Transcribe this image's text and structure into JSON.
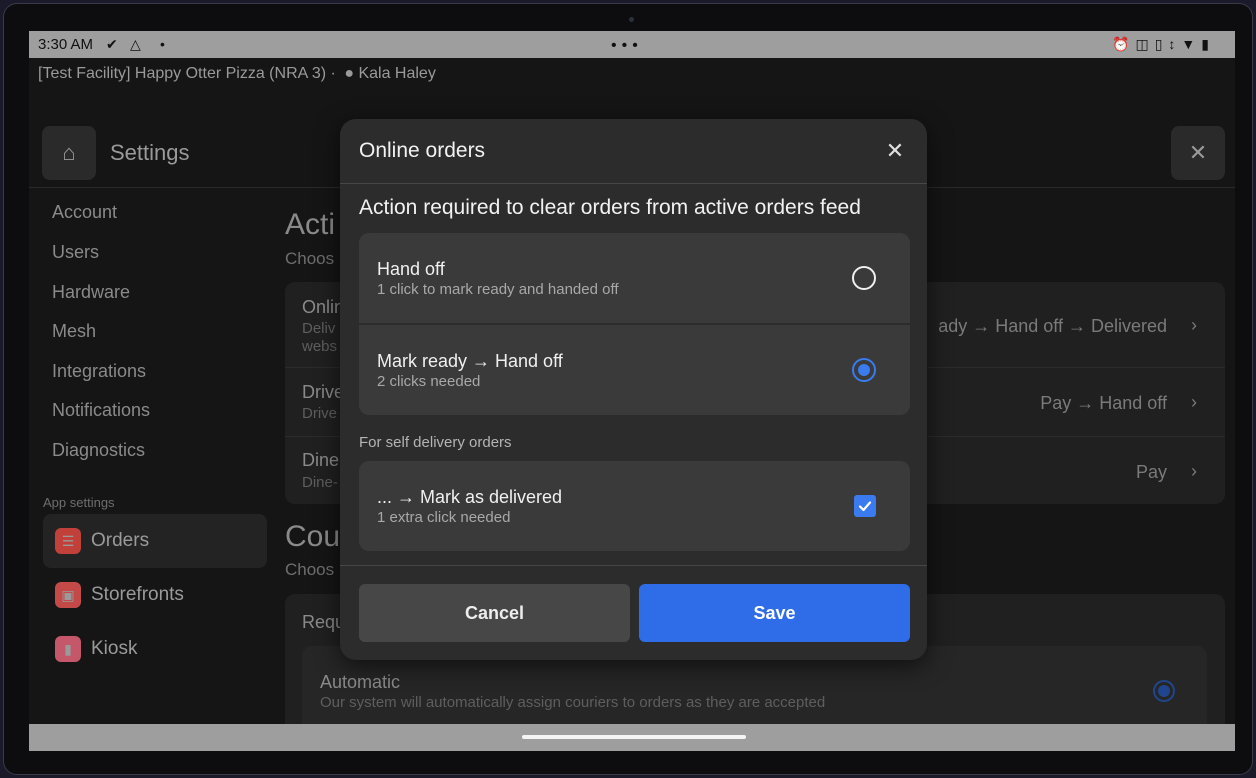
{
  "status_bar": {
    "time": "3:30 AM",
    "center_dots": "•••",
    "icons": [
      "check-circle-icon",
      "shield-icon",
      "dot-icon",
      "alarm-icon",
      "cast-icon",
      "vibrate-icon",
      "data-arrows-icon",
      "wifi-icon",
      "battery-icon"
    ]
  },
  "facility": {
    "name": "[Test Facility] Happy Otter Pizza (NRA 3)",
    "separator": "·",
    "user": "Kala Haley"
  },
  "header": {
    "title": "Settings"
  },
  "sidebar": {
    "items": [
      {
        "label": "Account"
      },
      {
        "label": "Users"
      },
      {
        "label": "Hardware"
      },
      {
        "label": "Mesh"
      },
      {
        "label": "Integrations"
      },
      {
        "label": "Notifications"
      },
      {
        "label": "Diagnostics"
      }
    ],
    "app_settings_label": "App settings",
    "app_items": [
      {
        "label": "Orders",
        "icon": "orders-icon",
        "color": "#c1413a"
      },
      {
        "label": "Storefronts",
        "icon": "storefront-icon",
        "color": "#c44a4a"
      },
      {
        "label": "Kiosk",
        "icon": "kiosk-icon",
        "color": "#c4586a"
      }
    ]
  },
  "background": {
    "section1_title": "Acti",
    "section1_sub": "Choos",
    "rows": [
      {
        "label": "Onlin",
        "sub1": "Deliv",
        "sub2": "webs",
        "right": "ady → Hand off → Delivered"
      },
      {
        "label": "Drive",
        "sub1": "Drive",
        "right": "Pay → Hand off"
      },
      {
        "label": "Dine",
        "sub1": "Dine-",
        "right": "Pay"
      }
    ],
    "section2_title": "Cou",
    "section2_sub": "Choos",
    "req_label": "Requ",
    "auto_label": "Automatic",
    "auto_sub": "Our system will automatically assign couriers to orders as they are accepted"
  },
  "modal": {
    "title": "Online orders",
    "heading": "Action required to clear orders from active orders feed",
    "options": [
      {
        "label": "Hand off",
        "sub": "1 click to mark ready and handed off",
        "selected": false
      },
      {
        "label": "Mark ready → Hand off",
        "sub": "2 clicks needed",
        "selected": true
      }
    ],
    "self_delivery_caption": "For self delivery orders",
    "self_delivery": {
      "label": "... → Mark as delivered",
      "sub": "1 extra click needed",
      "checked": true
    },
    "cancel_label": "Cancel",
    "save_label": "Save"
  },
  "colors": {
    "accent": "#2f6ce8",
    "radio_selected": "#3a7bef"
  }
}
